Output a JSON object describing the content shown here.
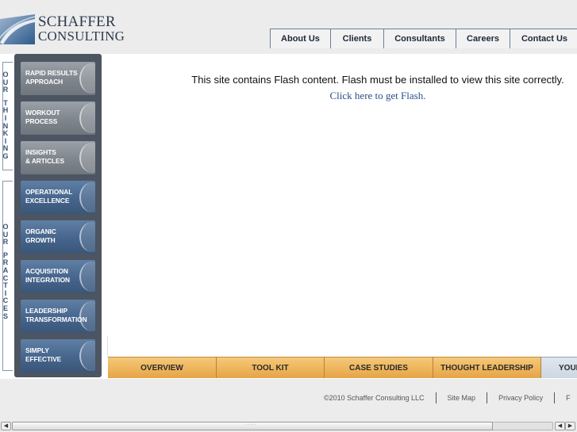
{
  "logo": {
    "line1": "SCHAFFER",
    "line2": "CONSULTING"
  },
  "topnav": {
    "items": [
      {
        "label": "About Us"
      },
      {
        "label": "Clients"
      },
      {
        "label": "Consultants"
      },
      {
        "label": "Careers"
      },
      {
        "label": "Contact Us"
      }
    ]
  },
  "sidebar": {
    "group_thinking_letters": [
      "O",
      "U",
      "R",
      "",
      "T",
      "H",
      "I",
      "N",
      "K",
      "I",
      "N",
      "G"
    ],
    "group_practices_letters": [
      "O",
      "U",
      "R",
      "",
      "P",
      "R",
      "A",
      "C",
      "T",
      "I",
      "C",
      "E",
      "S"
    ],
    "buttons": [
      {
        "line1": "RAPID RESULTS",
        "line2": "APPROACH"
      },
      {
        "line1": "WORKOUT",
        "line2": "PROCESS"
      },
      {
        "line1": "INSIGHTS",
        "line2": "& ARTICLES"
      },
      {
        "line1": "OPERATIONAL",
        "line2": "EXCELLENCE"
      },
      {
        "line1": "ORGANIC",
        "line2": "GROWTH"
      },
      {
        "line1": "ACQUISITION",
        "line2": "INTEGRATION"
      },
      {
        "line1": "LEADERSHIP",
        "line2": "TRANSFORMATION"
      },
      {
        "line1": "SIMPLY",
        "line2": "EFFECTIVE"
      }
    ]
  },
  "main": {
    "flash_message": "This site contains Flash content. Flash must be installed to view this site correctly.",
    "flash_link": "Click here to get Flash."
  },
  "bottom_tabs": [
    {
      "label": "OVERVIEW"
    },
    {
      "label": "TOOL KIT"
    },
    {
      "label": "CASE STUDIES"
    },
    {
      "label": "THOUGHT LEADERSHIP"
    },
    {
      "label": "YOUR"
    }
  ],
  "footer": {
    "copyright": "©2010 Schaffer Consulting LLC",
    "sitemap": "Site Map",
    "privacy": "Privacy Policy",
    "more": "F"
  },
  "colors": {
    "navy": "#2e3b4e",
    "sidebar_blue": "#46658c",
    "sidebar_grey": "#7e858c",
    "tab_orange": "#edb359",
    "link_blue": "#2a4f8a"
  }
}
